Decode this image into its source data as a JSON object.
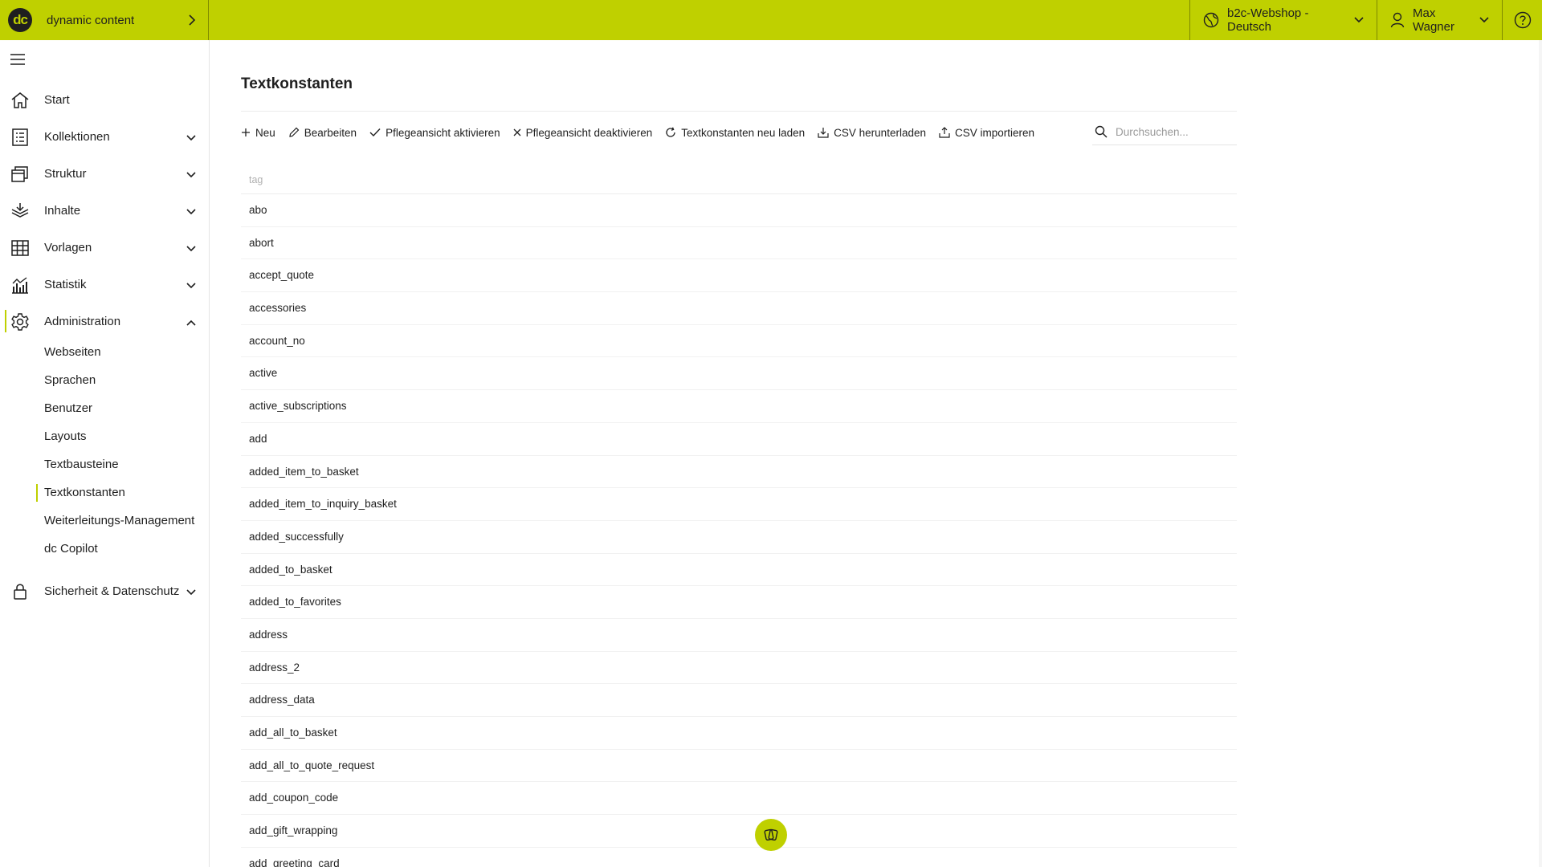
{
  "brand": {
    "logo_text": "dc",
    "name": "dynamic content"
  },
  "topbar": {
    "site_selector": "b2c-Webshop - Deutsch",
    "user_name": "Max Wagner"
  },
  "sidebar": {
    "items": [
      {
        "label": "Start",
        "icon": "home-icon"
      },
      {
        "label": "Kollektionen",
        "icon": "collection-icon"
      },
      {
        "label": "Struktur",
        "icon": "structure-icon"
      },
      {
        "label": "Inhalte",
        "icon": "content-icon"
      },
      {
        "label": "Vorlagen",
        "icon": "grid-icon"
      },
      {
        "label": "Statistik",
        "icon": "chart-icon"
      },
      {
        "label": "Administration",
        "icon": "gear-icon"
      },
      {
        "label": "Sicherheit & Datenschutz",
        "icon": "lock-icon"
      }
    ],
    "admin_sub": [
      "Webseiten",
      "Sprachen",
      "Benutzer",
      "Layouts",
      "Textbausteine",
      "Textkonstanten",
      "Weiterleitungs-Management",
      "dc Copilot"
    ]
  },
  "main": {
    "title": "Textkonstanten",
    "toolbar": {
      "new": "Neu",
      "edit": "Bearbeiten",
      "activate": "Pflegeansicht aktivieren",
      "deactivate": "Pflegeansicht deaktivieren",
      "reload": "Textkonstanten neu laden",
      "download": "CSV herunterladen",
      "import": "CSV importieren"
    },
    "search_placeholder": "Durchsuchen...",
    "column_header": "tag",
    "rows": [
      "abo",
      "abort",
      "accept_quote",
      "accessories",
      "account_no",
      "active",
      "active_subscriptions",
      "add",
      "added_item_to_basket",
      "added_item_to_inquiry_basket",
      "added_successfully",
      "added_to_basket",
      "added_to_favorites",
      "address",
      "address_2",
      "address_data",
      "add_all_to_basket",
      "add_all_to_quote_request",
      "add_coupon_code",
      "add_gift_wrapping",
      "add_greeting_card"
    ]
  },
  "colors": {
    "accent": "#bfd000",
    "text": "#1f1f1f"
  }
}
